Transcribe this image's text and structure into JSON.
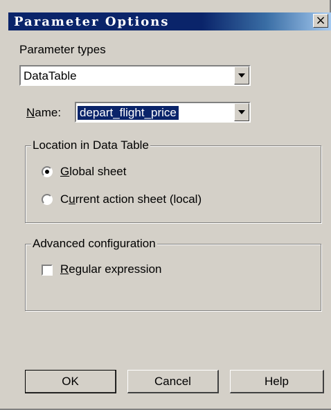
{
  "window": {
    "title": "Parameter Options",
    "close_glyph": "×"
  },
  "parameter_types": {
    "label": "Parameter types",
    "selected": "DataTable"
  },
  "name": {
    "label_prefix": "N",
    "label_rest": "ame:",
    "selected": "depart_flight_price"
  },
  "location_group": {
    "title": "Location in Data Table",
    "global": {
      "u": "G",
      "rest": "lobal sheet",
      "checked": true
    },
    "current": {
      "pre": "C",
      "u": "u",
      "rest": "rrent action sheet (local)",
      "checked": false
    }
  },
  "advanced_group": {
    "title": "Advanced configuration",
    "regex": {
      "u": "R",
      "rest": "egular expression",
      "checked": false
    }
  },
  "buttons": {
    "ok": "OK",
    "cancel": "Cancel",
    "help": "Help"
  }
}
